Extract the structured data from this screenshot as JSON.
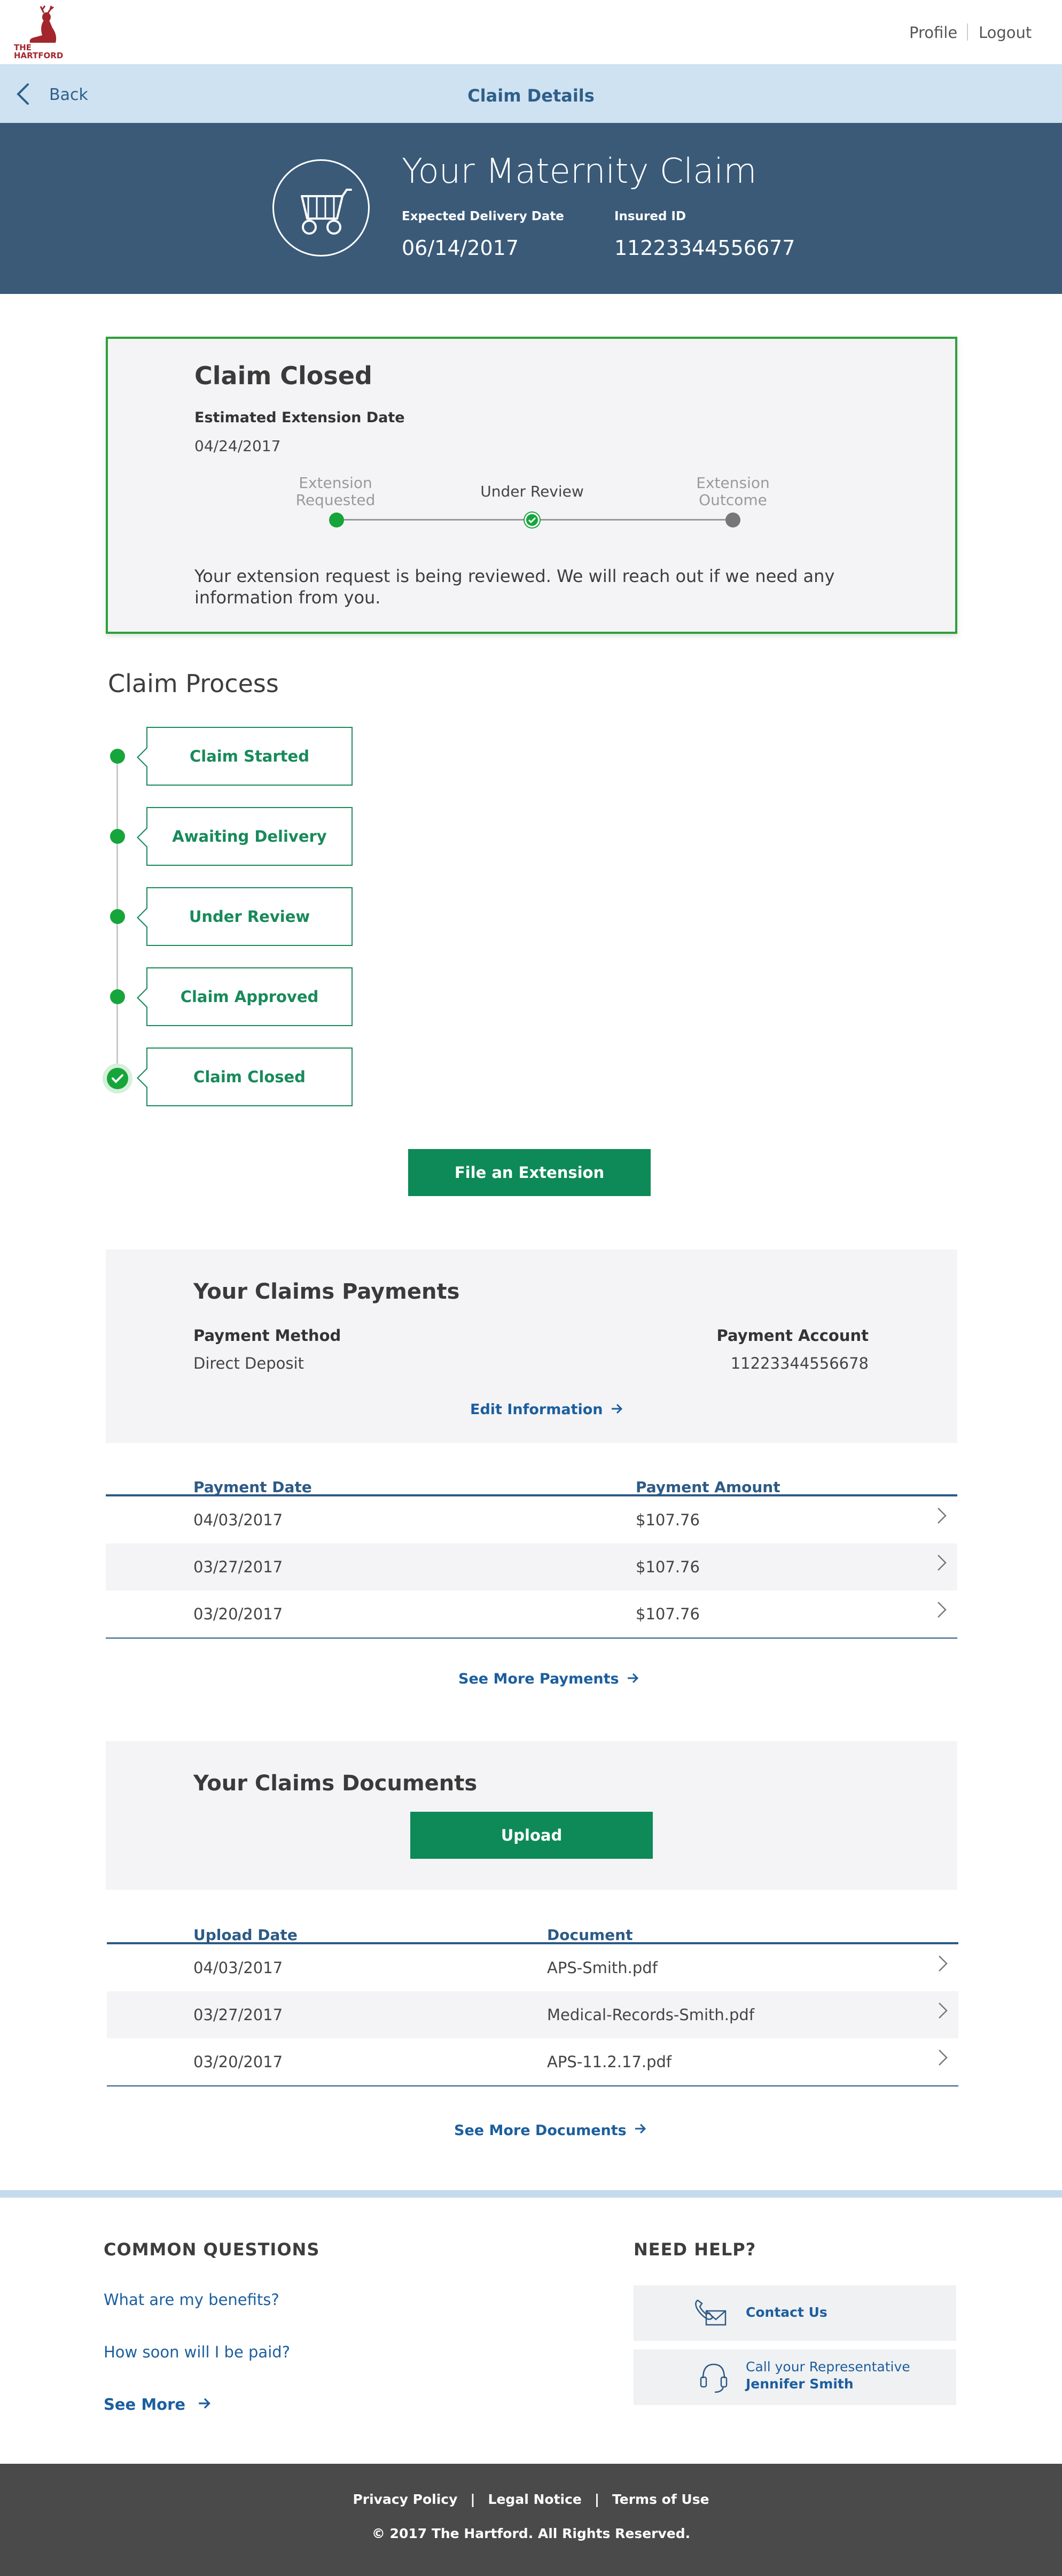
{
  "brand": {
    "logo_text": "THE HARTFORD"
  },
  "nav": {
    "profile": "Profile",
    "logout": "Logout"
  },
  "subheader": {
    "back": "Back",
    "title": "Claim Details"
  },
  "hero": {
    "title": "Your Maternity Claim",
    "delivery_label": "Expected Delivery Date",
    "delivery_value": "06/14/2017",
    "insured_label": "Insured ID",
    "insured_value": "11223344556677",
    "icon": "stroller-icon"
  },
  "status": {
    "title": "Claim Closed",
    "est_label": "Estimated Extension Date",
    "est_value": "04/24/2017",
    "steps": [
      {
        "label_line1": "Extension",
        "label_line2": "Requested",
        "state": "complete"
      },
      {
        "label_line1": "Under Review",
        "label_line2": "",
        "state": "current"
      },
      {
        "label_line1": "Extension",
        "label_line2": "Outcome",
        "state": "pending"
      }
    ],
    "message": "Your extension request is being reviewed. We will reach out if we need any information from you."
  },
  "process": {
    "title": "Claim Process",
    "steps": [
      "Claim Started",
      "Awaiting Delivery",
      "Under Review",
      "Claim Approved",
      "Claim Closed"
    ]
  },
  "file_extension_button": "File an Extension",
  "payments": {
    "title": "Your Claims Payments",
    "method_label": "Payment Method",
    "method_value": "Direct Deposit",
    "account_label": "Payment Account",
    "account_value": "11223344556678",
    "edit_link": "Edit Information",
    "col_date": "Payment Date",
    "col_amount": "Payment Amount",
    "rows": [
      {
        "date": "04/03/2017",
        "amount": "$107.76"
      },
      {
        "date": "03/27/2017",
        "amount": "$107.76"
      },
      {
        "date": "03/20/2017",
        "amount": "$107.76"
      }
    ],
    "see_more": "See More Payments"
  },
  "documents": {
    "title": "Your Claims Documents",
    "upload_button": "Upload",
    "col_date": "Upload Date",
    "col_doc": "Document",
    "rows": [
      {
        "date": "04/03/2017",
        "doc": "APS-Smith.pdf"
      },
      {
        "date": "03/27/2017",
        "doc": "Medical-Records-Smith.pdf"
      },
      {
        "date": "03/20/2017",
        "doc": "APS-11.2.17.pdf"
      }
    ],
    "see_more": "See More Documents"
  },
  "faq": {
    "title": "COMMON QUESTIONS",
    "links": [
      "What are my benefits?",
      "How soon will I be paid?"
    ],
    "see_more": "See More"
  },
  "help": {
    "title": "NEED HELP?",
    "contact": "Contact Us",
    "rep_line1": "Call your Representative",
    "rep_line2": "Jennifer Smith"
  },
  "footer": {
    "privacy": "Privacy Policy",
    "legal": "Legal Notice",
    "terms": "Terms of Use",
    "sep": "|",
    "copyright": "© 2017 The Hartford. All Rights Reserved."
  },
  "colors": {
    "hero_bg": "#3a5a78",
    "subheader_bg": "#cfe2f1",
    "accent_green": "#0d8a57",
    "status_green": "#15a53b",
    "link_blue": "#1c5e9e",
    "footer_bg": "#4a4a4a"
  }
}
